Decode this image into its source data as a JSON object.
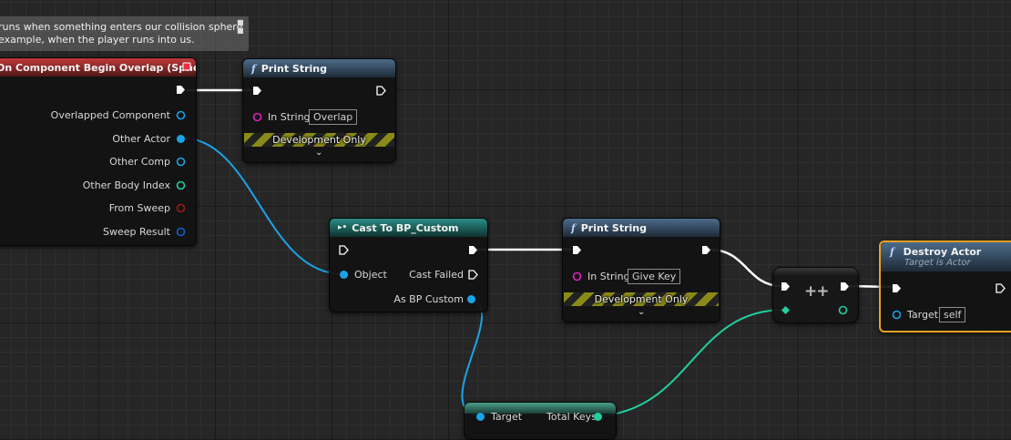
{
  "comment": {
    "line1": "runs when something enters our collision sphere",
    "line2": "example, when the player runs into us."
  },
  "event_node": {
    "title": "On Component Begin Overlap (Sphere)",
    "pins": [
      "Overlapped Component",
      "Other Actor",
      "Other Comp",
      "Other Body Index",
      "From Sweep",
      "Sweep Result"
    ]
  },
  "print_string_1": {
    "title": "Print String",
    "in_string_label": "In String",
    "in_string_value": "Overlap",
    "dev_only": "Development Only"
  },
  "cast_node": {
    "title": "Cast To BP_Custom",
    "object_label": "Object",
    "cast_failed_label": "Cast Failed",
    "as_label": "As BP Custom"
  },
  "print_string_2": {
    "title": "Print String",
    "in_string_label": "In String",
    "in_string_value": "Give Key",
    "dev_only": "Development Only"
  },
  "increment_node": {
    "symbol": "++"
  },
  "destroy_node": {
    "title": "Destroy Actor",
    "subtitle": "Target is Actor",
    "target_label": "Target",
    "target_value": "self"
  },
  "getter_node": {
    "target_label": "Target",
    "total_keys_label": "Total Keys"
  },
  "colors": {
    "exec": "#ffffff",
    "object": "#1aa3e8",
    "string": "#e020c0",
    "int": "#20d0a0",
    "bool": "#a01818",
    "struct": "#1060d0",
    "selection": "#f0a020"
  },
  "icons": {
    "function": "function-f-icon",
    "cast": "cast-arrows-icon",
    "comment_bubble": "comment-bubble-icon",
    "event_delegate": "delegate-square-icon"
  }
}
